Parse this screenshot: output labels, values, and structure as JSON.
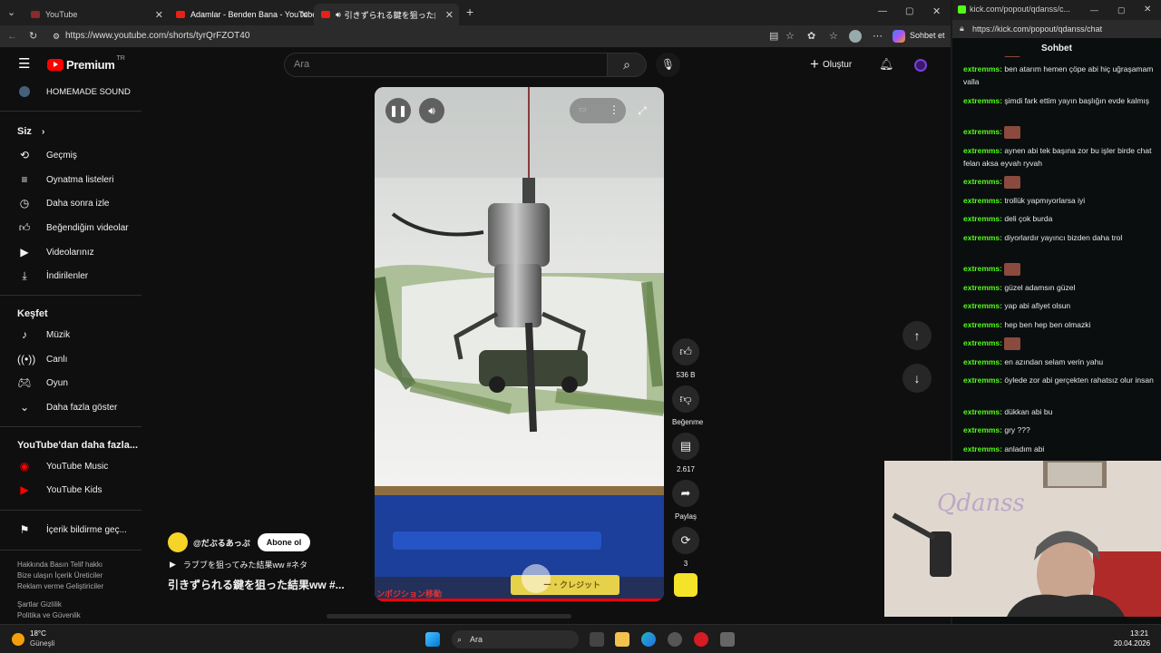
{
  "tabs": [
    {
      "label": "YouTube"
    },
    {
      "label": "Adamlar - Benden Bana - YouTube"
    },
    {
      "label": "引きずられる鍵を狙った結果ww #..."
    }
  ],
  "url": "https://www.youtube.com/shorts/tyrQrFZOT40",
  "browser_actions": {
    "chat_label": "Sohbet et"
  },
  "header": {
    "logo_text": "Premium",
    "logo_region": "TR",
    "search_placeholder": "Ara",
    "create_label": "Oluştur"
  },
  "sidebar": {
    "top_item": "HOMEMADE SOUND",
    "you_header": "Siz",
    "you_items": [
      {
        "label": "Geçmiş",
        "icon": "history-icon"
      },
      {
        "label": "Oynatma listeleri",
        "icon": "playlist-icon"
      },
      {
        "label": "Daha sonra izle",
        "icon": "clock-icon"
      },
      {
        "label": "Beğendiğim videolar",
        "icon": "thumb-up-icon"
      },
      {
        "label": "Videolarınız",
        "icon": "video-icon"
      },
      {
        "label": "İndirilenler",
        "icon": "download-icon"
      }
    ],
    "explore_header": "Keşfet",
    "explore_items": [
      {
        "label": "Müzik",
        "icon": "music-icon"
      },
      {
        "label": "Canlı",
        "icon": "live-icon"
      },
      {
        "label": "Oyun",
        "icon": "game-icon"
      },
      {
        "label": "Daha fazla göster",
        "icon": "chevron-down-icon"
      }
    ],
    "more_header": "YouTube'dan daha fazla...",
    "more_items": [
      {
        "label": "YouTube Music"
      },
      {
        "label": "YouTube Kids"
      }
    ],
    "report_label": "İçerik bildirme geç...",
    "footer1": "Hakkında  Basın  Telif hakkı",
    "footer2": "Bize ulaşın  İçerik Üreticiler",
    "footer3": "Reklam verme  Geliştiriciler",
    "footer4": "Şartlar  Gizlilik",
    "footer5": "Politika ve Güvenlik"
  },
  "short": {
    "channel": "@だぶるあっぷ",
    "subscribe_label": "Abone ol",
    "hashtags": "ラブブを狙ってみた結果ww #ネタ",
    "title": "引きずられる鍵を狙った結果ww #...",
    "overlay_text": "ンポジション移動",
    "overlay_text2": "ー・クレジット"
  },
  "actions": {
    "likes": "536 B",
    "dislike_label": "Beğenme",
    "comments": "2.617",
    "share_label": "Paylaş",
    "remix_count": "3"
  },
  "chat": {
    "url_short": "kick.com/popout/qdanss/c...",
    "url": "https://kick.com/popout/qdanss/chat",
    "title": "Sohbet",
    "messages": [
      {
        "user": "extremms:",
        "text": "",
        "emote": true
      },
      {
        "user": "extremms:",
        "text": "ben atarım hemen çöpe abi hiç uğraşamam valla"
      },
      {
        "user": "extremms:",
        "text": "şimdi fark ettim yayın başlığın evde kalmış"
      },
      {
        "user": "extremms:",
        "text": "",
        "emote": true
      },
      {
        "user": "extremms:",
        "text": "aynen abi tek başına zor bu işler birde chat felan aksa eyvah ryvah"
      },
      {
        "user": "extremms:",
        "text": "",
        "emote": true
      },
      {
        "user": "extremms:",
        "text": "trollük yapmıyorlarsa iyi"
      },
      {
        "user": "extremms:",
        "text": "deli çok burda"
      },
      {
        "user": "extremms:",
        "text": "diyorlardır yayıncı bizden daha trol"
      },
      {
        "user": "extremms:",
        "text": "",
        "emote": true
      },
      {
        "user": "extremms:",
        "text": "güzel adamsın güzel"
      },
      {
        "user": "extremms:",
        "text": "yap abi afiyet olsun"
      },
      {
        "user": "extremms:",
        "text": "hep ben hep ben olmazki"
      },
      {
        "user": "extremms:",
        "text": "",
        "emote": true
      },
      {
        "user": "extremms:",
        "text": "en azından selam verin yahu"
      },
      {
        "user": "extremms:",
        "text": "öylede zor abi gerçekten rahatsız olur insan"
      },
      {
        "user": "extremms:",
        "text": "dükkan abi bu"
      },
      {
        "user": "extremms:",
        "text": "gry ???"
      },
      {
        "user": "extremms:",
        "text": "anladım abi"
      }
    ]
  },
  "webcam": {
    "logo_text": "Qdanss"
  },
  "taskbar": {
    "weather_temp": "18°C",
    "weather_desc": "Güneşli",
    "search_label": "Ara",
    "time": "13:21",
    "date": "20.04.2026"
  }
}
